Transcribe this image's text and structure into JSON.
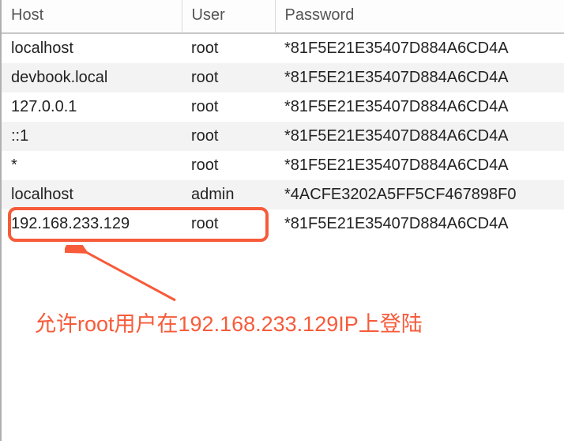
{
  "table": {
    "headers": {
      "host": "Host",
      "user": "User",
      "password": "Password"
    },
    "rows": [
      {
        "host": "localhost",
        "user": "root",
        "password": "*81F5E21E35407D884A6CD4A"
      },
      {
        "host": "devbook.local",
        "user": "root",
        "password": "*81F5E21E35407D884A6CD4A"
      },
      {
        "host": "127.0.0.1",
        "user": "root",
        "password": "*81F5E21E35407D884A6CD4A"
      },
      {
        "host": "::1",
        "user": "root",
        "password": "*81F5E21E35407D884A6CD4A"
      },
      {
        "host": "*",
        "user": "root",
        "password": "*81F5E21E35407D884A6CD4A"
      },
      {
        "host": "localhost",
        "user": "admin",
        "password": "*4ACFE3202A5FF5CF467898F0"
      },
      {
        "host": "192.168.233.129",
        "user": "root",
        "password": "*81F5E21E35407D884A6CD4A"
      }
    ]
  },
  "annotation": "允许root用户在192.168.233.129IP上登陆"
}
